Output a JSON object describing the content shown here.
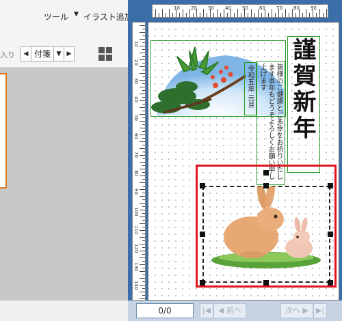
{
  "toolbar": {
    "tools_label": "ツール",
    "add_illust_label": "イラスト追加",
    "dropdown_arrow": "▼"
  },
  "left": {
    "truncated_label": "入り",
    "tag_label": "付箋",
    "prev_arrow": "◀",
    "next_arrow": "▶",
    "dropdown_arrow": "▼"
  },
  "card": {
    "title": "謹賀新年",
    "body": "皆様のご健康とご多幸をお祈りいたします本年もどうぞよろしくお願い申し上げます",
    "date": "令和五年 元旦"
  },
  "rulers": {
    "horizontal": [
      "10",
      "20",
      "30",
      "40",
      "50",
      "60",
      "70",
      "80",
      "90"
    ],
    "vertical": [
      "10",
      "20",
      "30",
      "40",
      "50",
      "60",
      "70",
      "80",
      "90",
      "100",
      "110",
      "120",
      "130",
      "140"
    ]
  },
  "pager": {
    "page_indicator": "0/0",
    "first_icon": "first-page-icon",
    "prev_label": "前へ",
    "next_label": "次へ",
    "last_icon": "last-page-icon"
  },
  "colors": {
    "selection": "#e0141e",
    "guide": "#2a9a2a",
    "panel_blue": "#3b6ea8",
    "accent_orange": "#e07a1f"
  }
}
